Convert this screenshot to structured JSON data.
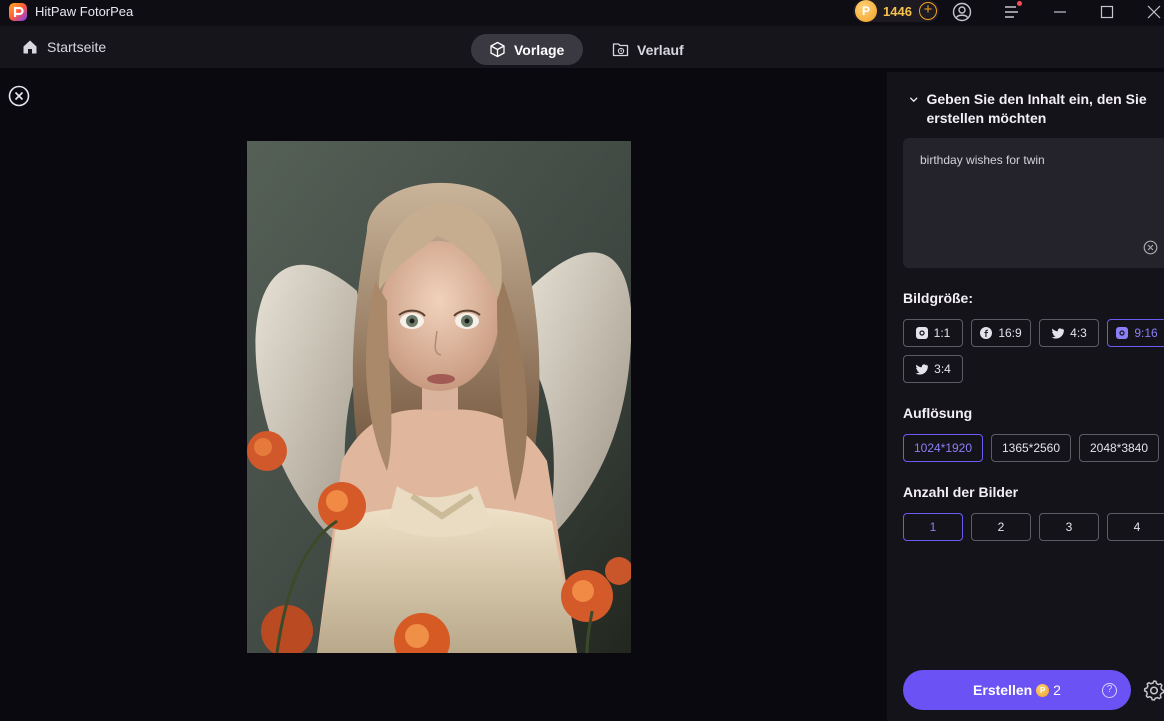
{
  "app": {
    "title": "HitPaw FotorPea"
  },
  "titlebar": {
    "coins": "1446",
    "coin_symbol": "P",
    "add_symbol": "+"
  },
  "nav": {
    "home_label": "Startseite",
    "tabs": [
      {
        "label": "Vorlage",
        "active": true,
        "icon": "cube-icon"
      },
      {
        "label": "Verlauf",
        "active": false,
        "icon": "history-folder-icon"
      }
    ]
  },
  "panel": {
    "prompt_heading": "Geben Sie den Inhalt ein, den Sie erstellen möchten",
    "prompt_value": "birthday wishes for twin",
    "size_label": "Bildgröße:",
    "sizes": [
      {
        "label": "1:1",
        "icon": "instagram-icon",
        "selected": false
      },
      {
        "label": "16:9",
        "icon": "facebook-icon",
        "selected": false
      },
      {
        "label": "4:3",
        "icon": "twitter-icon",
        "selected": false
      },
      {
        "label": "9:16",
        "icon": "instagram-icon",
        "selected": true
      },
      {
        "label": "3:4",
        "icon": "twitter-icon",
        "selected": false
      }
    ],
    "resolution_label": "Auflösung",
    "resolutions": [
      {
        "label": "1024*1920",
        "selected": true
      },
      {
        "label": "1365*2560",
        "selected": false
      },
      {
        "label": "2048*3840",
        "selected": false
      }
    ],
    "count_label": "Anzahl der Bilder",
    "counts": [
      {
        "label": "1",
        "selected": true
      },
      {
        "label": "2",
        "selected": false
      },
      {
        "label": "3",
        "selected": false
      },
      {
        "label": "4",
        "selected": false
      }
    ],
    "create_label": "Erstellen",
    "create_cost": "2",
    "help_symbol": "?"
  },
  "colors": {
    "accent": "#6a52f5",
    "accent_text": "#8b7ff7",
    "coin": "#f6c24d",
    "background": "#0b0910",
    "panel": "#15131a"
  }
}
